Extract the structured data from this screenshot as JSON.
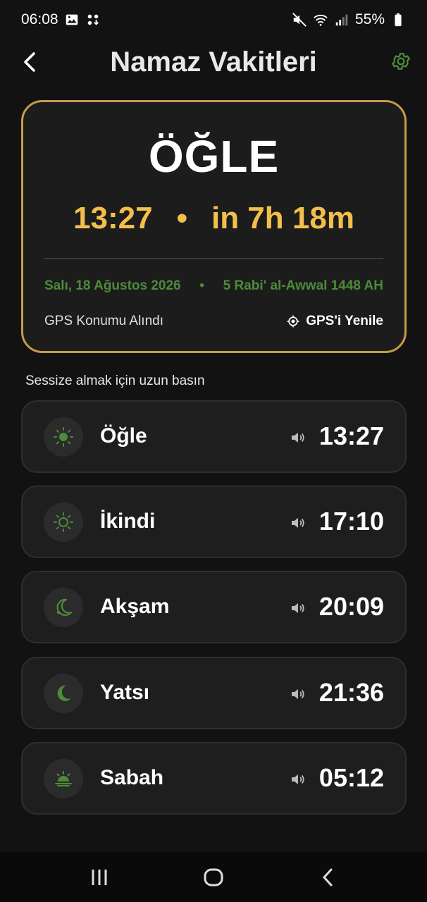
{
  "status_bar": {
    "time": "06:08",
    "battery": "55%"
  },
  "header": {
    "title": "Namaz Vakitleri"
  },
  "current_prayer": {
    "name": "ÖĞLE",
    "time": "13:27",
    "separator": "•",
    "countdown": "in 7h 18m",
    "gregorian_date": "Salı, 18 Ağustos 2026",
    "date_separator": "•",
    "hijri_date": "5 Rabi' al-Awwal 1448 AH",
    "gps_status": "GPS Konumu Alındı",
    "gps_refresh_label": "GPS'i Yenile"
  },
  "hint": "Sessize almak için uzun basın",
  "prayers": [
    {
      "name": "Öğle",
      "time": "13:27",
      "icon": "sun-filled-icon"
    },
    {
      "name": "İkindi",
      "time": "17:10",
      "icon": "sun-outline-icon"
    },
    {
      "name": "Akşam",
      "time": "20:09",
      "icon": "moon-outline-icon"
    },
    {
      "name": "Yatsı",
      "time": "21:36",
      "icon": "moon-filled-icon"
    },
    {
      "name": "Sabah",
      "time": "05:12",
      "icon": "sunrise-icon"
    }
  ],
  "colors": {
    "accent_gold": "#f2c04a",
    "card_border": "#c79a4b",
    "accent_green": "#4d8b3a",
    "background": "#121212"
  }
}
